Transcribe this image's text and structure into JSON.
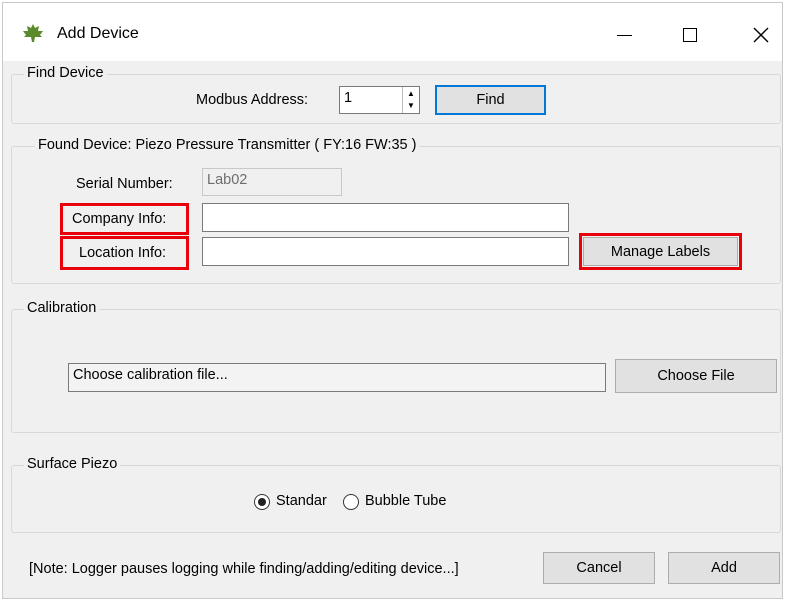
{
  "window": {
    "title": "Add Device",
    "controls": {
      "minimize": "—",
      "maximize": "☐",
      "close": "X"
    }
  },
  "find_device": {
    "legend": "Find Device",
    "modbus_label": "Modbus Address:",
    "modbus_value": "1",
    "find_button": "Find"
  },
  "found_device": {
    "legend": "Found Device: Piezo Pressure Transmitter ( FY:16 FW:35 )",
    "serial_label": "Serial Number:",
    "serial_value": "Lab02",
    "company_label": "Company Info:",
    "company_value": "",
    "location_label": "Location Info:",
    "location_value": "",
    "manage_labels_button": "Manage Labels"
  },
  "calibration": {
    "legend": "Calibration",
    "file_placeholder": "Choose calibration file...",
    "choose_file_button": "Choose File"
  },
  "surface_piezo": {
    "legend": "Surface Piezo",
    "options": [
      {
        "label": "Standar",
        "selected": true
      },
      {
        "label": "Bubble Tube",
        "selected": false
      }
    ]
  },
  "footer": {
    "note": "[Note: Logger pauses logging while finding/adding/editing device...]",
    "cancel_button": "Cancel",
    "add_button": "Add"
  },
  "colors": {
    "highlight": "#e8000b",
    "focus": "#0078d7",
    "background": "#f0f0f0"
  }
}
